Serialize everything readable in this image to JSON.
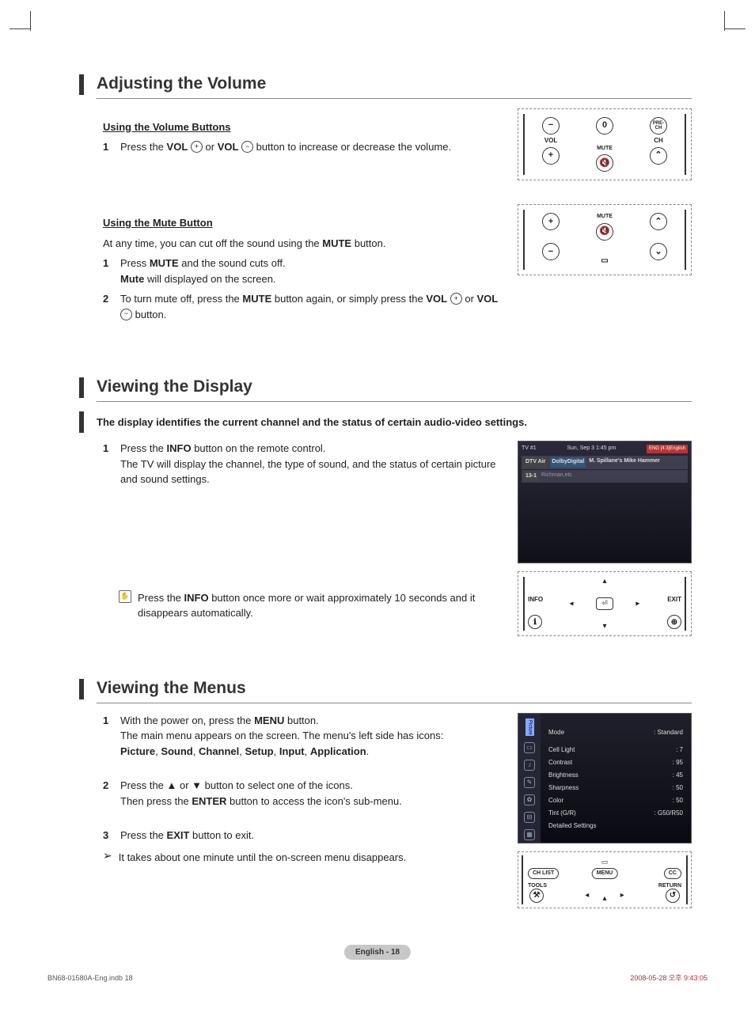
{
  "sec1": {
    "title": "Adjusting the Volume",
    "sub1": "Using the Volume Buttons",
    "step1_a": "Press the ",
    "step1_b": "VOL",
    "step1_c": " or ",
    "step1_d": "VOL",
    "step1_e": " button to increase or decrease the volume.",
    "sub2": "Using the Mute Button",
    "mute_intro_a": "At any time, you can cut off the sound using the ",
    "mute_intro_b": "MUTE",
    "mute_intro_c": " button.",
    "m1_a": "Press ",
    "m1_b": "MUTE",
    "m1_c": " and the sound cuts off.",
    "m1_d": "Mute",
    "m1_e": " will displayed on the screen.",
    "m2_a": "To turn mute off, press the ",
    "m2_b": "MUTE",
    "m2_c": " button again, or simply press the ",
    "m2_d": "VOL",
    "m2_e": " or ",
    "m2_f": "VOL",
    "m2_g": " button."
  },
  "remote1": {
    "vol": "VOL",
    "ch": "CH",
    "prech": "PRE-CH",
    "zero": "0",
    "minus": "−",
    "plus": "+",
    "up": "⌃",
    "mute": "MUTE"
  },
  "remote2": {
    "plus": "+",
    "minus": "−",
    "up": "⌃",
    "down": "⌄",
    "mute": "MUTE"
  },
  "sec2": {
    "title": "Viewing the Display",
    "intro": "The display identifies the current channel and the status of certain audio-video settings.",
    "s1_a": "Press the ",
    "s1_b": "INFO",
    "s1_c": " button on the remote control.",
    "s1_d": "The TV will display the channel, the type of sound, and the status of certain picture and sound settings.",
    "note_a": "Press the ",
    "note_b": "INFO",
    "note_c": " button once more or wait approximately 10 seconds and it disappears automatically."
  },
  "info_display": {
    "tv": "TV #1",
    "time": "Sun, Sep 3   1:45 pm",
    "badge": "ENG [4:3]English",
    "src": "DTV Air",
    "dd": "DolbyDigital",
    "ch": "13-1",
    "prog": "M. Spillane's Mike Hammer",
    "sub": "Richman,etc"
  },
  "nav": {
    "info": "INFO",
    "exit": "EXIT",
    "enter": "⏎",
    "i": "ℹ",
    "x": "⊕"
  },
  "sec3": {
    "title": "Viewing the Menus",
    "s1_a": "With the power on, press the ",
    "s1_b": "MENU",
    "s1_c": " button.",
    "s1_d": "The main menu appears on the screen. The menu's left side has icons:",
    "s1_e": "Picture",
    "s1_f": ", ",
    "s1_g": "Sound",
    "s1_h": ", ",
    "s1_i": "Channel",
    "s1_j": ", ",
    "s1_k": "Setup",
    "s1_l": ", ",
    "s1_m": "Input",
    "s1_n": ", ",
    "s1_o": "Application",
    "s1_p": ".",
    "s2_a": "Press the ▲ or ▼ button to select one of the icons.",
    "s2_b": "Then press the ",
    "s2_c": "ENTER",
    "s2_d": " button to access the icon's sub-menu.",
    "s3_a": "Press the ",
    "s3_b": "EXIT",
    "s3_c": " button to exit.",
    "note": "It takes about one minute until the on-screen menu disappears."
  },
  "menu": {
    "side": "Picture",
    "items": [
      {
        "k": "Mode",
        "v": ": Standard"
      },
      {
        "k": "Cell Light",
        "v": ": 7"
      },
      {
        "k": "Contrast",
        "v": ": 95"
      },
      {
        "k": "Brightness",
        "v": ": 45"
      },
      {
        "k": "Sharpness",
        "v": ": 50"
      },
      {
        "k": "Color",
        "v": ": 50"
      },
      {
        "k": "Tint (G/R)",
        "v": ": G50/R50"
      },
      {
        "k": "Detailed Settings",
        "v": ""
      }
    ]
  },
  "menu_remote": {
    "chlist": "CH LIST",
    "menu": "MENU",
    "cc": "CC",
    "tools": "TOOLS",
    "return": "RETURN"
  },
  "footer": {
    "page": "English - 18",
    "left": "BN68-01580A-Eng.indb   18",
    "right": "2008-05-28   오후 9:43:05"
  },
  "nums": {
    "n1": "1",
    "n2": "2",
    "n3": "3"
  },
  "sym": {
    "plus": "+",
    "minus": "−",
    "arrow": "➢",
    "info": "ℹ"
  }
}
